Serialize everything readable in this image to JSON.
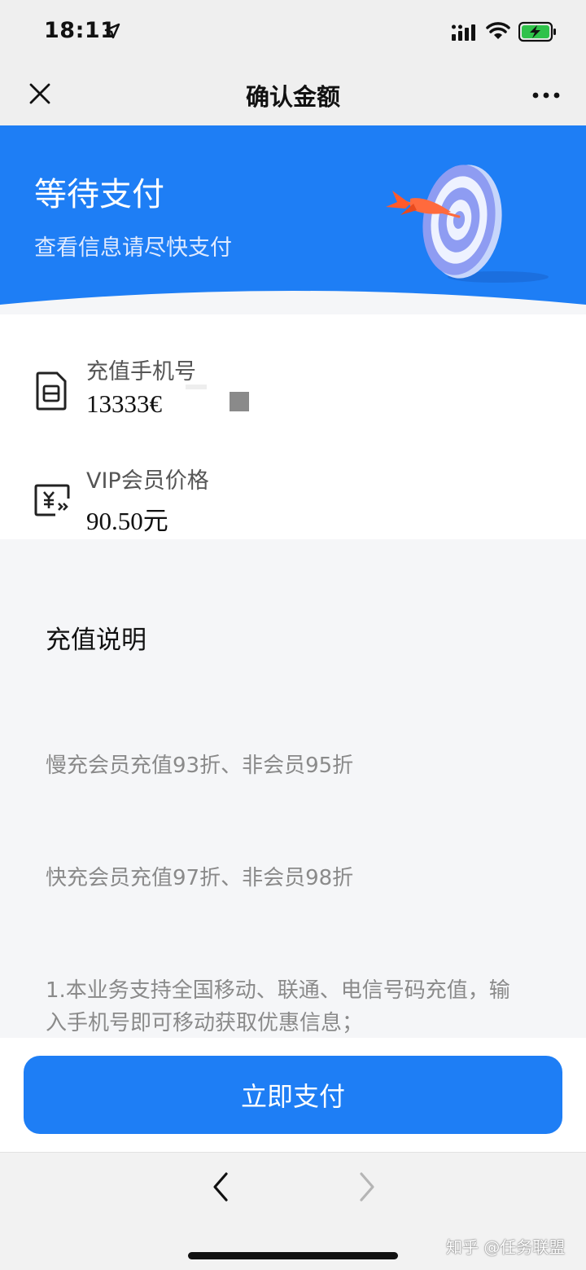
{
  "status_bar": {
    "time": "18:11",
    "icons": [
      "location-arrow-icon",
      "signal-icon",
      "wifi-icon",
      "battery-charging-icon"
    ]
  },
  "nav": {
    "title": "确认金额",
    "close_icon": "close-icon",
    "more_icon": "more-icon"
  },
  "banner": {
    "title": "等待支付",
    "subtitle": "查看信息请尽快支付",
    "illustration": "dart-target",
    "background_color": "#1e7ef5"
  },
  "info": {
    "phone": {
      "label": "充值手机号",
      "value": "13333€",
      "icon": "sim-card-icon"
    },
    "price": {
      "label": "VIP会员价格",
      "value": "90.50元",
      "icon": "yuan-transfer-icon"
    }
  },
  "description": {
    "heading": "充值说明",
    "lines": [
      "慢充会员充值93折、非会员95折",
      "快充会员充值97折、非会员98折",
      "1.本业务支持全国移动、联通、电信号码充值，输入手机号即可移动获取优惠信息；"
    ]
  },
  "pay": {
    "button_label": "立即支付",
    "button_color": "#1e7ef5"
  },
  "toolbar": {
    "back_icon": "chevron-left-icon",
    "forward_icon": "chevron-right-icon"
  },
  "watermark": "知乎 @任务联盟"
}
